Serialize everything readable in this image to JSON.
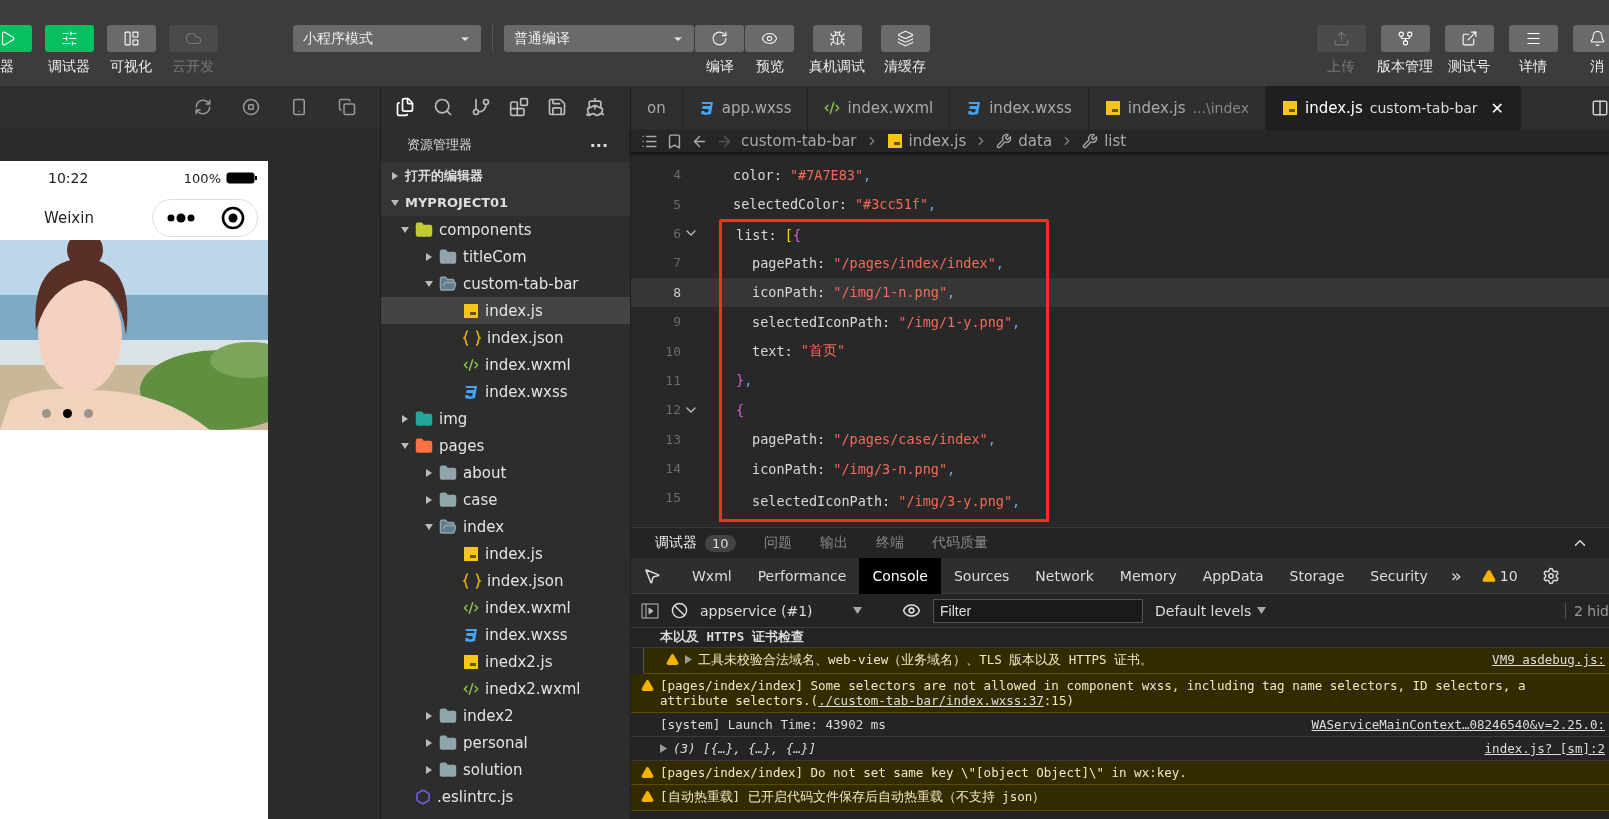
{
  "toolbar": {
    "left_buttons": [
      {
        "label": "器",
        "selected": true,
        "disabled": false
      },
      {
        "label": "调试器",
        "selected": true,
        "disabled": false
      },
      {
        "label": "可视化",
        "selected": false,
        "disabled": false
      },
      {
        "label": "云开发",
        "selected": false,
        "disabled": true
      }
    ],
    "mode_select": "小程序模式",
    "compile_select": "普通编译",
    "compile_actions": [
      {
        "label": "编译"
      },
      {
        "label": "预览"
      }
    ],
    "debug_actions": [
      {
        "label": "真机调试"
      },
      {
        "label": "清缓存"
      }
    ],
    "right_buttons": [
      {
        "label": "上传",
        "disabled": true
      },
      {
        "label": "版本管理",
        "disabled": false
      },
      {
        "label": "测试号",
        "disabled": false
      },
      {
        "label": "详情",
        "disabled": false
      },
      {
        "label": "消",
        "disabled": false
      }
    ]
  },
  "simulator": {
    "time": "10:22",
    "battery": "100%",
    "title": "Weixin",
    "carousel": {
      "kind": "picture",
      "dots": [
        {
          "selected": false
        },
        {
          "selected": true
        },
        {
          "selected": false
        }
      ]
    }
  },
  "explorer": {
    "title": "资源管理器",
    "menu": "···",
    "sections": [
      {
        "label": "打开的编辑器",
        "expanded": false
      },
      {
        "label": "MYPROJECT01",
        "expanded": true
      }
    ],
    "tree": [
      {
        "name": "components",
        "kind": "folder-components",
        "expanded": true,
        "children": [
          {
            "name": "titleCom",
            "kind": "folder",
            "expanded": false
          },
          {
            "name": "custom-tab-bar",
            "kind": "folder",
            "expanded": true,
            "children": [
              {
                "name": "index.js",
                "kind": "js",
                "selected": true
              },
              {
                "name": "index.json",
                "kind": "json",
                "selected": false
              },
              {
                "name": "index.wxml",
                "kind": "wxml",
                "selected": false
              },
              {
                "name": "index.wxss",
                "kind": "wxss",
                "selected": false
              }
            ]
          }
        ]
      },
      {
        "name": "img",
        "kind": "folder-img",
        "expanded": false
      },
      {
        "name": "pages",
        "kind": "folder-pages",
        "expanded": true,
        "children": [
          {
            "name": "about",
            "kind": "folder",
            "expanded": false
          },
          {
            "name": "case",
            "kind": "folder",
            "expanded": false
          },
          {
            "name": "index",
            "kind": "folder",
            "expanded": true,
            "children": [
              {
                "name": "index.js",
                "kind": "js",
                "selected": false
              },
              {
                "name": "index.json",
                "kind": "json",
                "selected": false
              },
              {
                "name": "index.wxml",
                "kind": "wxml",
                "selected": false
              },
              {
                "name": "index.wxss",
                "kind": "wxss",
                "selected": false
              },
              {
                "name": "inedx2.js",
                "kind": "js",
                "selected": false
              },
              {
                "name": "inedx2.wxml",
                "kind": "wxml",
                "selected": false
              }
            ]
          },
          {
            "name": "index2",
            "kind": "folder",
            "expanded": false
          },
          {
            "name": "personal",
            "kind": "folder",
            "expanded": false
          },
          {
            "name": "solution",
            "kind": "folder",
            "expanded": false
          }
        ]
      },
      {
        "name": ".eslintrc.js",
        "kind": "eslint",
        "selected": false
      }
    ]
  },
  "editor": {
    "tabs": [
      {
        "label": "on",
        "kind": "none",
        "selected": false
      },
      {
        "label": "app.wxss",
        "kind": "wxss",
        "selected": false
      },
      {
        "label": "index.wxml",
        "kind": "wxml",
        "selected": false
      },
      {
        "label": "index.wxss",
        "kind": "wxss",
        "selected": false
      },
      {
        "label": "index.js",
        "detail": "...\\index",
        "kind": "js",
        "selected": false
      },
      {
        "label": "index.js",
        "detail": "custom-tab-bar",
        "kind": "js",
        "selected": true,
        "close": "✕"
      }
    ],
    "breadcrumb": [
      {
        "label": "custom-tab-bar",
        "kind": "none"
      },
      {
        "label": "index.js",
        "kind": "js"
      },
      {
        "label": "data",
        "kind": "wrench"
      },
      {
        "label": "list",
        "kind": "wrench"
      }
    ],
    "lines": [
      {
        "number": "4",
        "indent": false,
        "foldable": false,
        "current": false,
        "highlighted": false,
        "tokens": [
          {
            "kind": "key",
            "text": "color: "
          },
          {
            "kind": "string",
            "text": "\"#7A7E83\""
          },
          {
            "kind": "punct",
            "text": ","
          }
        ]
      },
      {
        "number": "5",
        "indent": false,
        "foldable": false,
        "current": false,
        "highlighted": false,
        "tokens": [
          {
            "kind": "key",
            "text": "selectedColor: "
          },
          {
            "kind": "string",
            "text": "\"#3cc51f\""
          },
          {
            "kind": "punct",
            "text": ","
          }
        ]
      },
      {
        "number": "6",
        "indent": false,
        "foldable": true,
        "current": false,
        "highlighted": true,
        "tokens": [
          {
            "kind": "key",
            "text": "list: "
          },
          {
            "kind": "bracket",
            "text": "["
          },
          {
            "kind": "brace",
            "text": "{"
          }
        ]
      },
      {
        "number": "7",
        "indent": true,
        "foldable": false,
        "current": false,
        "highlighted": true,
        "tokens": [
          {
            "kind": "key",
            "text": "pagePath: "
          },
          {
            "kind": "string",
            "text": "\"/pages/index/index\""
          },
          {
            "kind": "punct",
            "text": ","
          }
        ]
      },
      {
        "number": "8",
        "indent": true,
        "foldable": false,
        "current": true,
        "highlighted": true,
        "tokens": [
          {
            "kind": "key",
            "text": "iconPath: "
          },
          {
            "kind": "string",
            "text": "\"/img/1-n.png\""
          },
          {
            "kind": "punct",
            "text": ","
          }
        ]
      },
      {
        "number": "9",
        "indent": true,
        "foldable": false,
        "current": false,
        "highlighted": true,
        "tokens": [
          {
            "kind": "key",
            "text": "selectedIconPath: "
          },
          {
            "kind": "string",
            "text": "\"/img/1-y.png\""
          },
          {
            "kind": "punct",
            "text": ","
          }
        ]
      },
      {
        "number": "10",
        "indent": true,
        "foldable": false,
        "current": false,
        "highlighted": true,
        "tokens": [
          {
            "kind": "key",
            "text": "text: "
          },
          {
            "kind": "string",
            "text": "\"首页\""
          }
        ]
      },
      {
        "number": "11",
        "indent": false,
        "foldable": false,
        "current": false,
        "highlighted": true,
        "tokens": [
          {
            "kind": "brace",
            "text": "}"
          },
          {
            "kind": "punct",
            "text": ","
          }
        ]
      },
      {
        "number": "12",
        "indent": false,
        "foldable": true,
        "current": false,
        "highlighted": true,
        "tokens": [
          {
            "kind": "brace",
            "text": "{"
          }
        ]
      },
      {
        "number": "13",
        "indent": true,
        "foldable": false,
        "current": false,
        "highlighted": true,
        "tokens": [
          {
            "kind": "key",
            "text": "pagePath: "
          },
          {
            "kind": "string",
            "text": "\"/pages/case/index\""
          },
          {
            "kind": "punct",
            "text": ","
          }
        ]
      },
      {
        "number": "14",
        "indent": true,
        "foldable": false,
        "current": false,
        "highlighted": true,
        "tokens": [
          {
            "kind": "key",
            "text": "iconPath: "
          },
          {
            "kind": "string",
            "text": "\"/img/3-n.png\""
          },
          {
            "kind": "punct",
            "text": ","
          }
        ]
      },
      {
        "number": "15",
        "indent": true,
        "foldable": false,
        "current": false,
        "highlighted": true,
        "tokens": [
          {
            "kind": "key",
            "text": "selectedIconPath: "
          },
          {
            "kind": "string",
            "text": "\"/img/3-y.png\""
          },
          {
            "kind": "punct",
            "text": ","
          }
        ]
      }
    ]
  },
  "panel": {
    "tabs": [
      {
        "label": "调试器",
        "badge": "10",
        "selected": true
      },
      {
        "label": "问题",
        "selected": false
      },
      {
        "label": "输出",
        "selected": false
      },
      {
        "label": "终端",
        "selected": false
      },
      {
        "label": "代码质量",
        "selected": false
      }
    ],
    "devtools_tabs": [
      {
        "label": "Wxml",
        "selected": false
      },
      {
        "label": "Performance",
        "selected": false
      },
      {
        "label": "Console",
        "selected": true
      },
      {
        "label": "Sources",
        "selected": false
      },
      {
        "label": "Network",
        "selected": false
      },
      {
        "label": "Memory",
        "selected": false
      },
      {
        "label": "AppData",
        "selected": false
      },
      {
        "label": "Storage",
        "selected": false
      },
      {
        "label": "Security",
        "selected": false
      }
    ],
    "more": "»",
    "warning_count": "10",
    "console_toolbar": {
      "context": "appservice (#1)",
      "filter_placeholder": "Filter",
      "levels": "Default levels",
      "hidden": "2 hid"
    },
    "messages": [
      {
        "kind": "heading",
        "text": "本以及 HTTPS 证书检查"
      },
      {
        "kind": "warning",
        "nested": true,
        "expandable": true,
        "text": "工具未校验合法域名、web-view（业务域名）、TLS 版本以及 HTTPS 证书。",
        "source": "VM9 asdebug.js:"
      },
      {
        "kind": "warning",
        "nested": false,
        "expandable": false,
        "text": "[pages/index/index] Some selectors are not allowed in component wxss, including tag name selectors, ID selectors, a",
        "continuation": {
          "text": "attribute selectors.(",
          "link": "./custom-tab-bar/index.wxss:37",
          "after": ":15)"
        }
      },
      {
        "kind": "info",
        "nested": false,
        "expandable": false,
        "text": "[system] Launch Time: 43902 ms",
        "source": "WAServiceMainContext…08246540&v=2.25.0:"
      },
      {
        "kind": "log",
        "nested": false,
        "expandable": true,
        "text": "(3) [{…}, {…}, {…}]",
        "source": "index.js? [sm]:2"
      },
      {
        "kind": "warning",
        "nested": false,
        "expandable": false,
        "text": "[pages/index/index] Do not set same key \\\"[object Object]\\\" in wx:key."
      },
      {
        "kind": "warning",
        "nested": false,
        "expandable": false,
        "text": "[自动热重载] 已开启代码文件保存后自动热重载（不支持 json）"
      }
    ]
  }
}
